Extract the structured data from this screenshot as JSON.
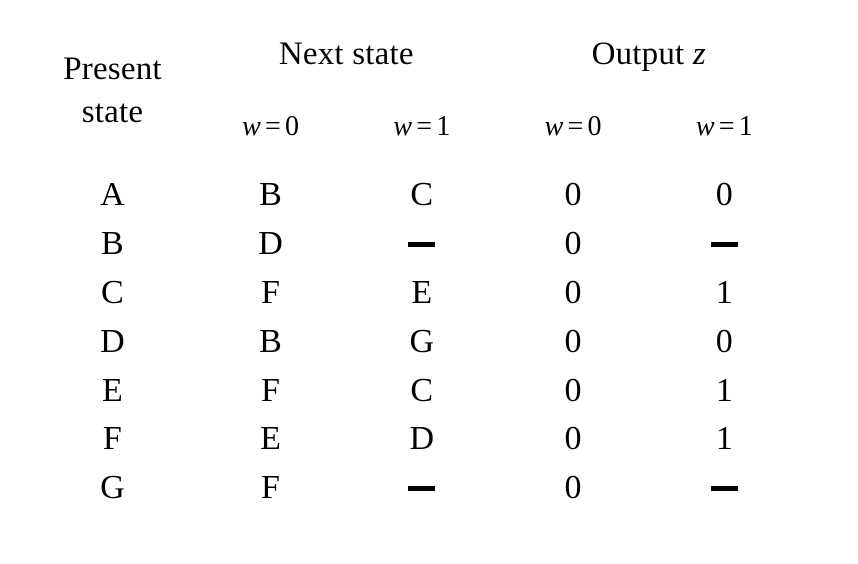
{
  "table": {
    "headers": {
      "present_state_line1": "Present",
      "present_state_line2": "state",
      "next_state": "Next state",
      "output_label": "Output",
      "output_var": "z",
      "sub": {
        "var": "w",
        "eq": "=",
        "val0": "0",
        "val1": "1"
      }
    },
    "columns": [
      "Present state",
      "Next state w = 0",
      "Next state w = 1",
      "Output z w = 0",
      "Output z w = 1"
    ],
    "rows": [
      {
        "present": "A",
        "next_w0": "B",
        "next_w1": "C",
        "out_w0": "0",
        "out_w1": "0"
      },
      {
        "present": "B",
        "next_w0": "D",
        "next_w1": "—",
        "out_w0": "0",
        "out_w1": "—"
      },
      {
        "present": "C",
        "next_w0": "F",
        "next_w1": "E",
        "out_w0": "0",
        "out_w1": "1"
      },
      {
        "present": "D",
        "next_w0": "B",
        "next_w1": "G",
        "out_w0": "0",
        "out_w1": "0"
      },
      {
        "present": "E",
        "next_w0": "F",
        "next_w1": "C",
        "out_w0": "0",
        "out_w1": "1"
      },
      {
        "present": "F",
        "next_w0": "E",
        "next_w1": "D",
        "out_w0": "0",
        "out_w1": "1"
      },
      {
        "present": "G",
        "next_w0": "F",
        "next_w1": "—",
        "out_w0": "0",
        "out_w1": "—"
      }
    ],
    "colors": {
      "border": "#000000",
      "text": "#000000",
      "background": "#ffffff"
    }
  }
}
